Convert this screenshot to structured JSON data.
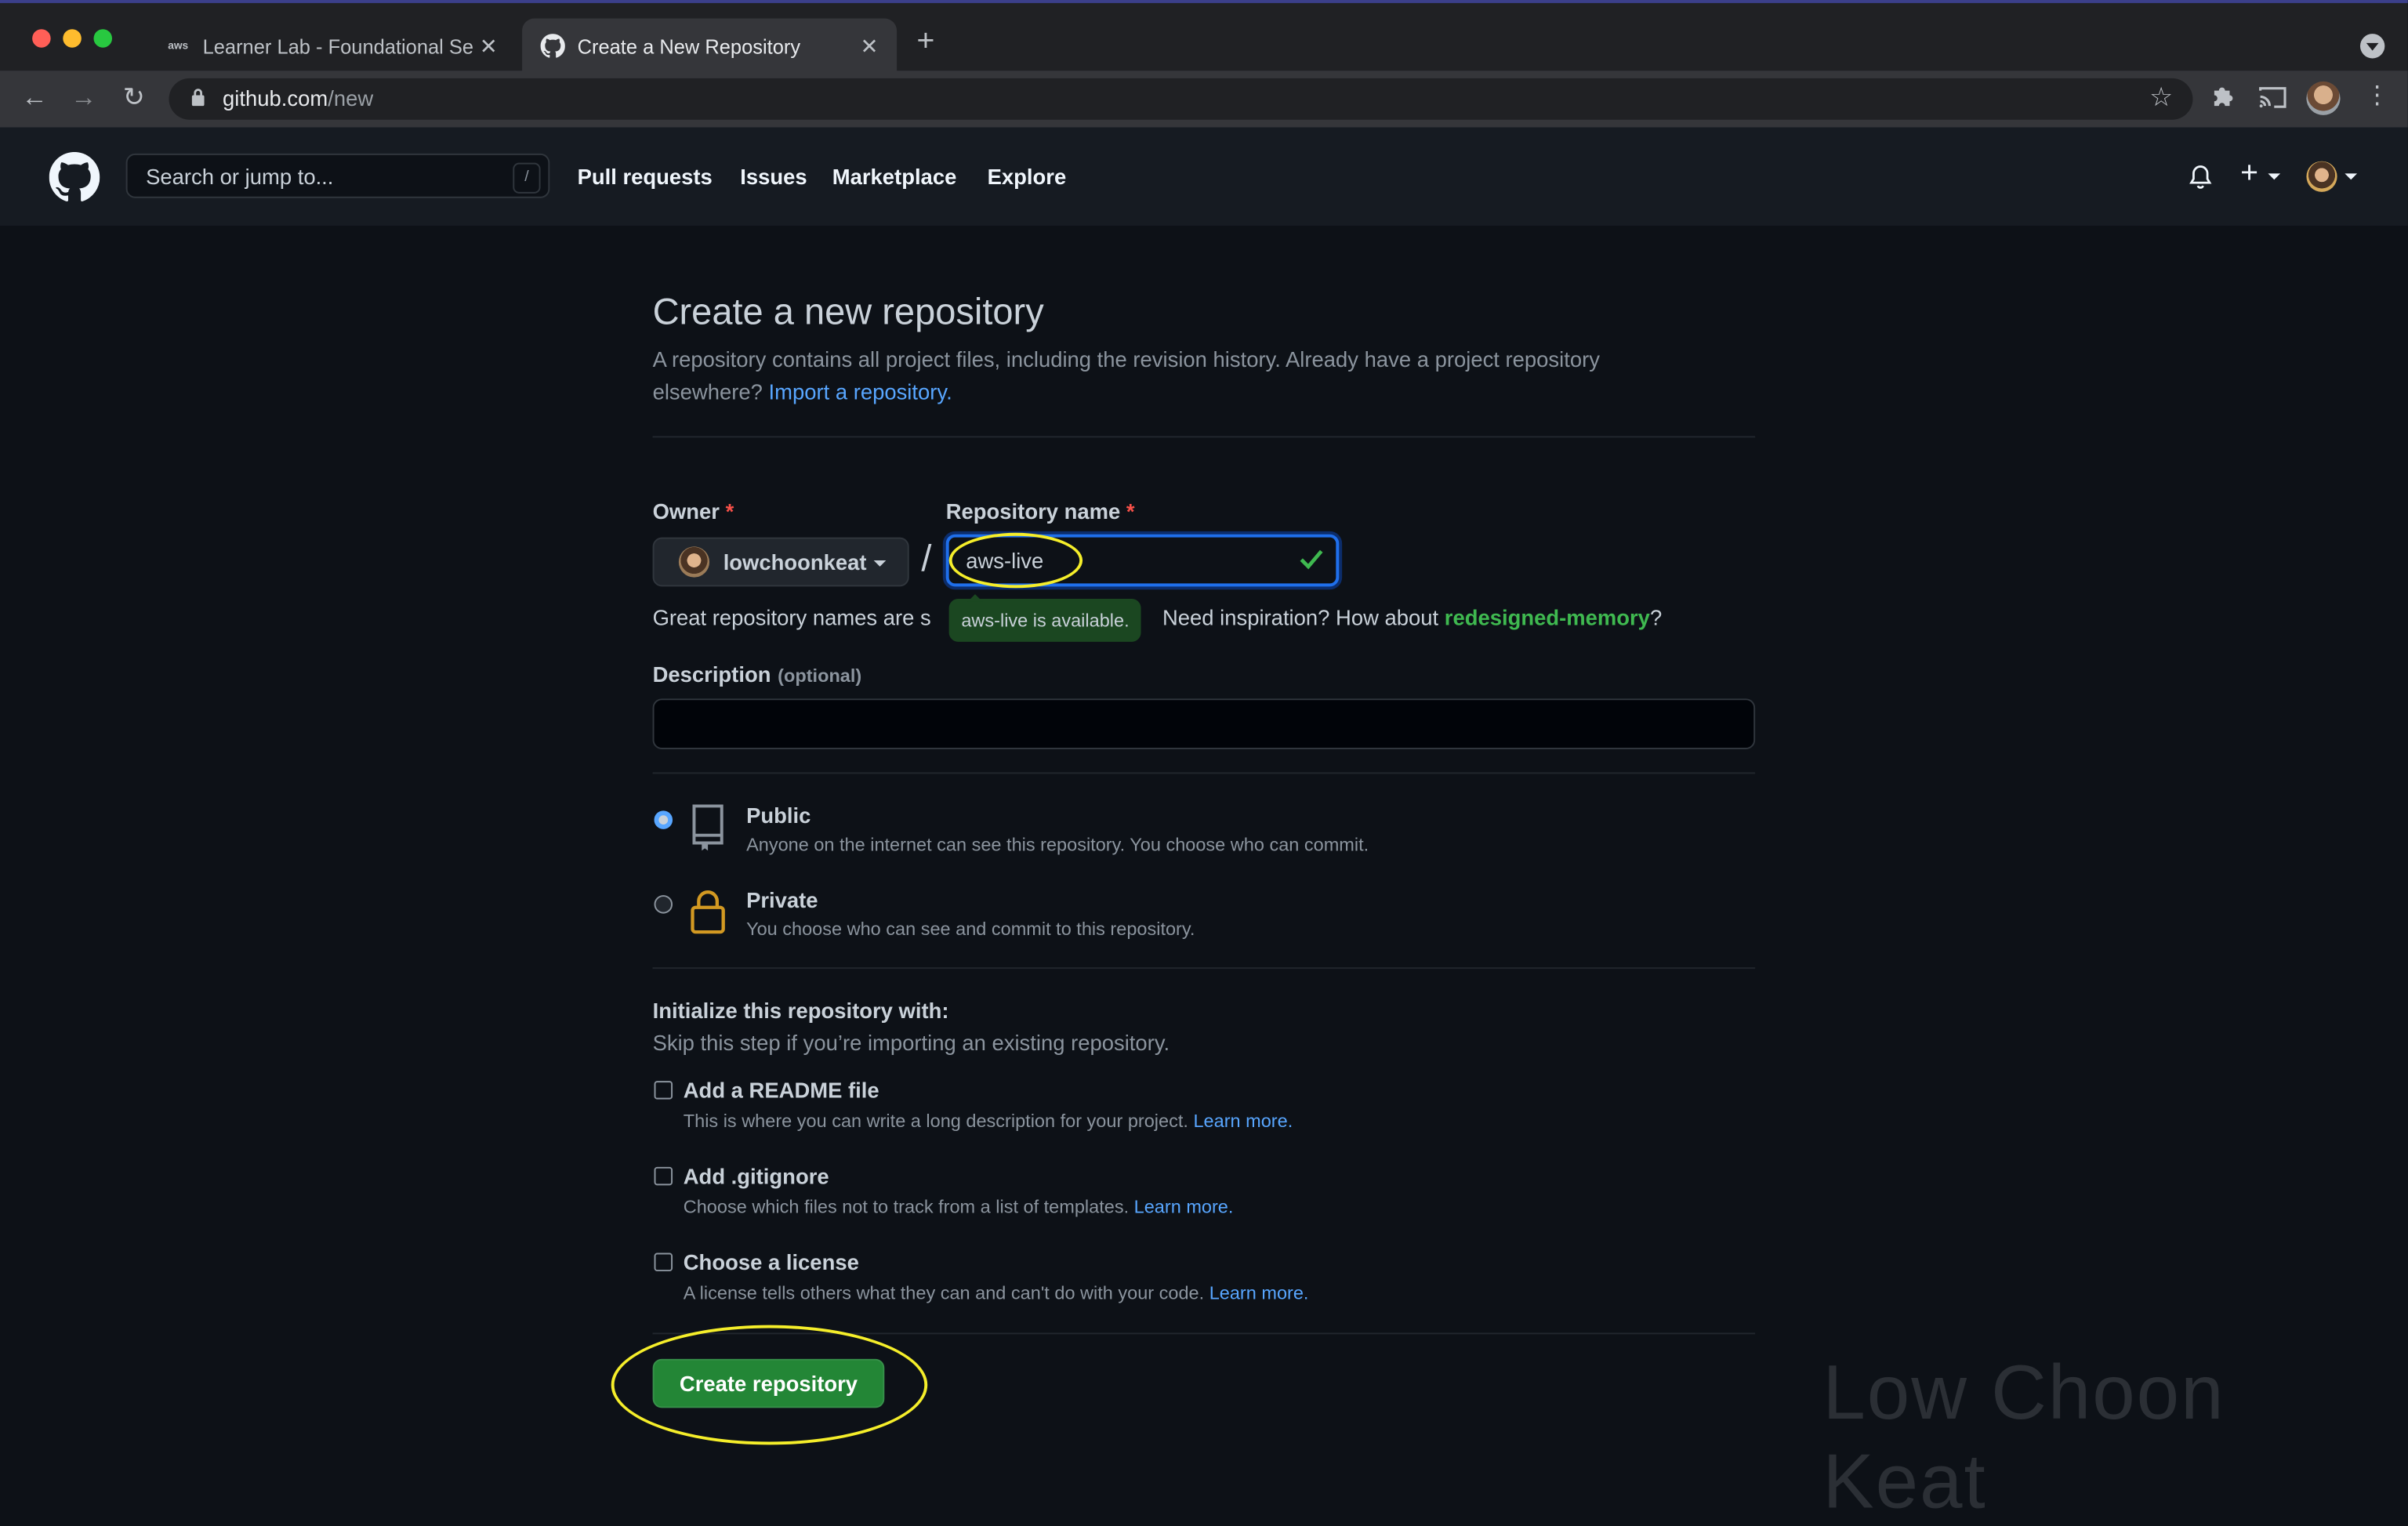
{
  "browser": {
    "tabs": [
      {
        "label": "Learner Lab - Foundational Se",
        "favicon": "aws-icon",
        "active": false
      },
      {
        "label": "Create a New Repository",
        "favicon": "github-icon",
        "active": true
      }
    ],
    "address": {
      "host": "github.com",
      "path": "/new"
    }
  },
  "header": {
    "search_placeholder": "Search or jump to...",
    "search_shortcut": "/",
    "nav": [
      "Pull requests",
      "Issues",
      "Marketplace",
      "Explore"
    ]
  },
  "page": {
    "title": "Create a new repository",
    "subtitle_line1": "A repository contains all project files, including the revision history. Already have a project repository",
    "subtitle_line2": "elsewhere?",
    "import_link": "Import a repository."
  },
  "form": {
    "owner_label": "Owner",
    "required_mark": "*",
    "owner_value": "lowchoonkeat",
    "slash": "/",
    "repo_label": "Repository name",
    "repo_value": "aws-live",
    "hint_prefix": "Great repository names are s",
    "tooltip": "aws-live is available.",
    "hint_suffix": "Need inspiration? How about",
    "suggestion": "redesigned-memory",
    "question_mark": "?",
    "description_label": "Description",
    "optional": "(optional)",
    "visibility": [
      {
        "title": "Public",
        "note": "Anyone on the internet can see this repository. You choose who can commit.",
        "selected": true
      },
      {
        "title": "Private",
        "note": "You choose who can see and commit to this repository.",
        "selected": false
      }
    ],
    "init_heading": "Initialize this repository with:",
    "init_sub": "Skip this step if you’re importing an existing repository.",
    "init_options": [
      {
        "title": "Add a README file",
        "note": "This is where you can write a long description for your project.",
        "link": "Learn more."
      },
      {
        "title": "Add .gitignore",
        "note": "Choose which files not to track from a list of templates.",
        "link": "Learn more."
      },
      {
        "title": "Choose a license",
        "note": "A license tells others what they can and can't do with your code.",
        "link": "Learn more."
      }
    ],
    "submit": "Create repository"
  },
  "watermark": "Low Choon Keat",
  "colors": {
    "accent": "#58a6ff",
    "primary_button": "#238636",
    "highlight": "#f5ee2a",
    "suggestion": "#3fb950"
  }
}
